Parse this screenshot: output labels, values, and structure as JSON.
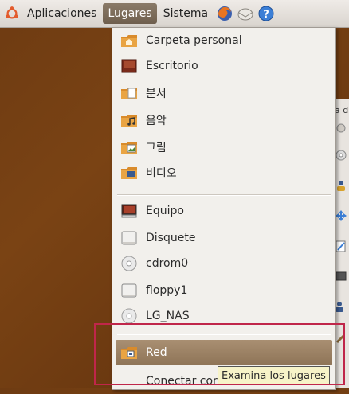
{
  "panel": {
    "menus": [
      "Aplicaciones",
      "Lugares",
      "Sistema"
    ],
    "active_menu": "Lugares",
    "launchers": [
      "firefox-icon",
      "mail-icon",
      "help-icon"
    ]
  },
  "places_menu": {
    "bookmarks": [
      {
        "label": "Carpeta personal",
        "icon": "home-folder-icon"
      },
      {
        "label": "Escritorio",
        "icon": "desktop-icon"
      },
      {
        "label": "분서",
        "icon": "documents-folder-icon"
      },
      {
        "label": "음악",
        "icon": "music-folder-icon"
      },
      {
        "label": "그림",
        "icon": "pictures-folder-icon"
      },
      {
        "label": "비디오",
        "icon": "videos-folder-icon"
      }
    ],
    "devices": [
      {
        "label": "Equipo",
        "icon": "computer-icon"
      },
      {
        "label": "Disquete",
        "icon": "floppy-drive-icon"
      },
      {
        "label": "cdrom0",
        "icon": "cdrom-icon"
      },
      {
        "label": "floppy1",
        "icon": "floppy-drive-icon"
      },
      {
        "label": "LG_NAS",
        "icon": "cdrom-icon"
      }
    ],
    "network": [
      {
        "label": "Red",
        "icon": "network-folder-icon",
        "highlighted": true
      },
      {
        "label": "Conectar cor",
        "icon": ""
      }
    ]
  },
  "tooltip": "Examina los lugares",
  "background_strip": {
    "text": "a d"
  },
  "colors": {
    "highlight": "#9a7f62",
    "focus_box": "#c0264a",
    "menu_bg": "#f2f0ec"
  }
}
